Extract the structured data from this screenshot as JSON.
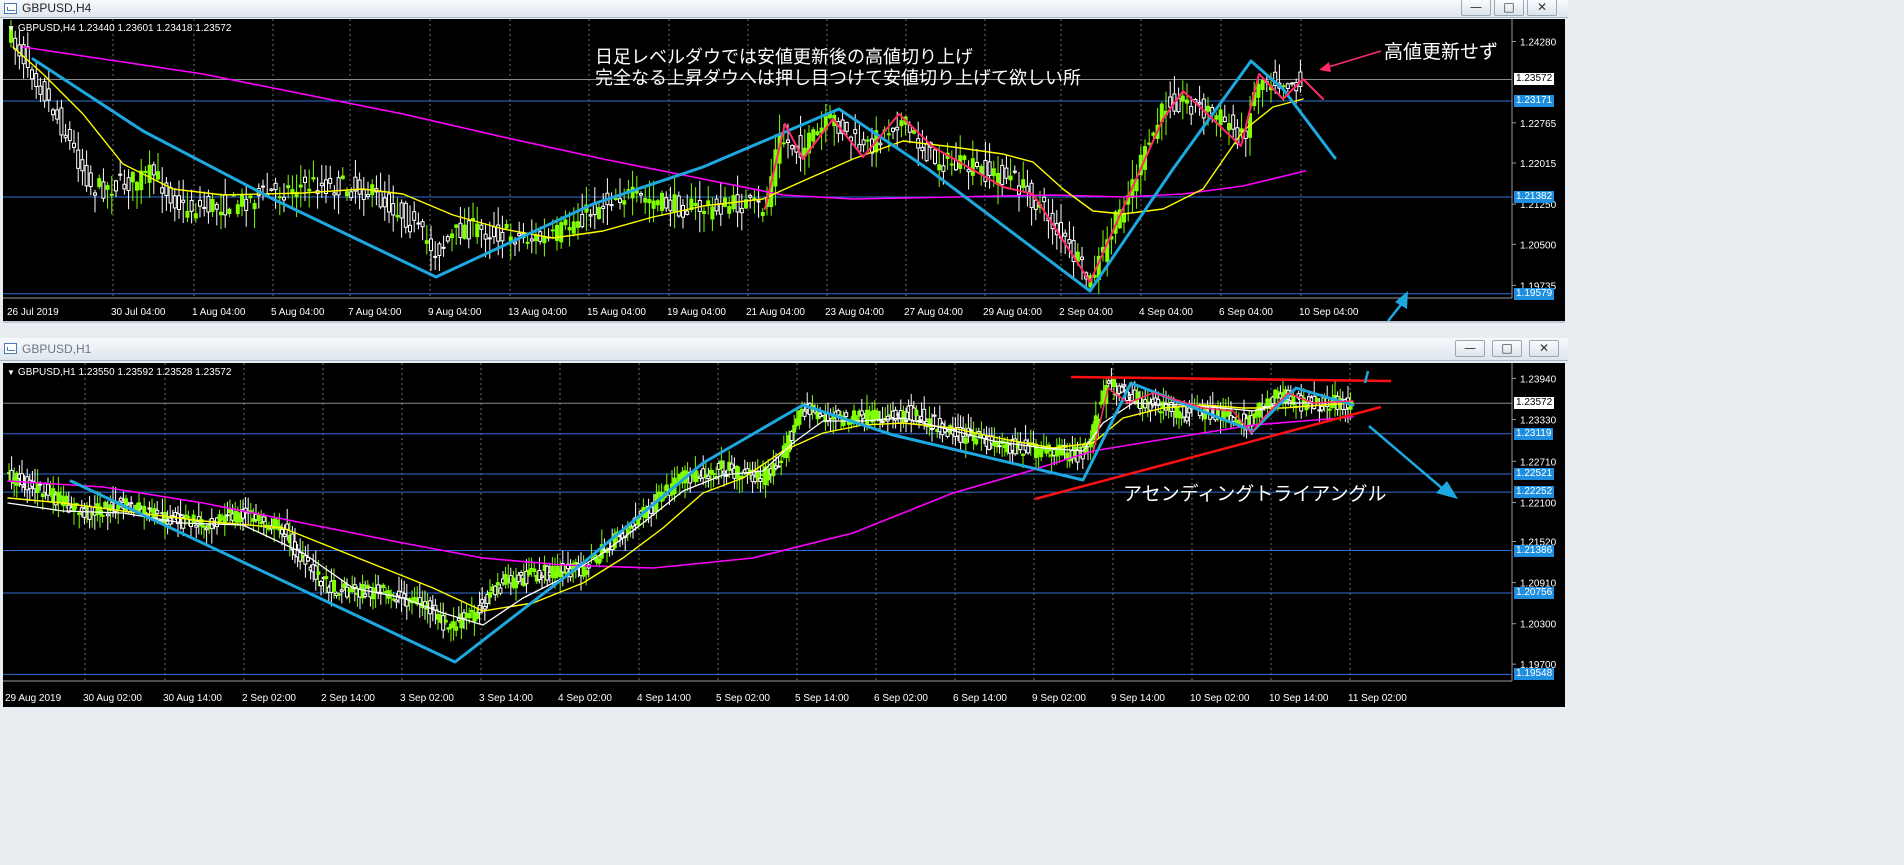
{
  "top_window": {
    "title": "GBPUSD,H4",
    "header": "GBPUSD,H4  1.23440 1.23601 1.23418 1.23572",
    "annotation_line1": "日足レベルダウでは安値更新後の高値切り上げ",
    "annotation_line2": "完全なる上昇ダウへは押し目つけて安値切り上げて欲しい所",
    "annotation_right": "高値更新せず",
    "y_ticks": [
      "1.24280",
      "1.22765",
      "1.22015",
      "1.21250",
      "1.20500",
      "1.19735"
    ],
    "y_range": [
      1.195,
      1.2455
    ],
    "price_tags": [
      {
        "label": "1.23572",
        "kind": "current"
      },
      {
        "label": "1.23171",
        "kind": "line"
      },
      {
        "label": "1.21382",
        "kind": "line"
      },
      {
        "label": "1.19579",
        "kind": "line"
      }
    ],
    "x_ticks": [
      "26 Jul 2019",
      "30 Jul 04:00",
      "1 Aug 04:00",
      "5 Aug 04:00",
      "7 Aug 04:00",
      "9 Aug 04:00",
      "13 Aug 04:00",
      "15 Aug 04:00",
      "19 Aug 04:00",
      "21 Aug 04:00",
      "23 Aug 04:00",
      "27 Aug 04:00",
      "29 Aug 04:00",
      "2 Sep 04:00",
      "4 Sep 04:00",
      "6 Sep 04:00",
      "10 Sep 04:00"
    ]
  },
  "bottom_window": {
    "title": "GBPUSD,H1",
    "header": "GBPUSD,H1  1.23550 1.23592 1.23528 1.23572",
    "annotation": "アセンディングトライアングル",
    "y_ticks": [
      "1.23940",
      "1.23330",
      "1.22710",
      "1.22100",
      "1.21520",
      "1.20910",
      "1.20300",
      "1.19700"
    ],
    "y_range": [
      1.1945,
      1.2405
    ],
    "price_tags": [
      {
        "label": "1.23572",
        "kind": "current"
      },
      {
        "label": "1.23119",
        "kind": "line"
      },
      {
        "label": "1.22521",
        "kind": "line"
      },
      {
        "label": "1.22252",
        "kind": "line"
      },
      {
        "label": "1.21386",
        "kind": "line"
      },
      {
        "label": "1.20756",
        "kind": "line"
      },
      {
        "label": "1.19548",
        "kind": "line"
      }
    ],
    "x_ticks": [
      "29 Aug 2019",
      "30 Aug 02:00",
      "30 Aug 14:00",
      "2 Sep 02:00",
      "2 Sep 14:00",
      "3 Sep 02:00",
      "3 Sep 14:00",
      "4 Sep 02:00",
      "4 Sep 14:00",
      "5 Sep 02:00",
      "5 Sep 14:00",
      "6 Sep 02:00",
      "6 Sep 14:00",
      "9 Sep 02:00",
      "9 Sep 14:00",
      "10 Sep 02:00",
      "10 Sep 14:00",
      "11 Sep 02:00"
    ]
  },
  "window_buttons": {
    "minimize": "—",
    "maximize": "□",
    "close": "✕"
  },
  "colors": {
    "bull_candle": "#7fff00",
    "bear_candle": "#ffffff",
    "ma_yellow": "#ffff00",
    "ma_magenta": "#ff00ff",
    "ma_white": "#ffffff",
    "trend_blue": "#1ea8e0",
    "trend_pink": "#ff2a6a",
    "triangle_red": "#ff1010",
    "grid": "#6f6f6f",
    "hline": "#2f6fd6"
  }
}
